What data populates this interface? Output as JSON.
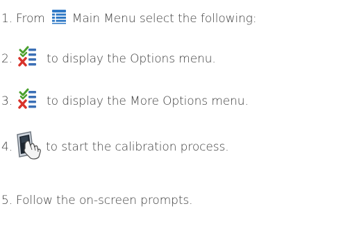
{
  "steps": [
    {
      "number": "1.",
      "prefix": "From",
      "icon": "main-menu-icon",
      "text": "Main Menu select the following:"
    },
    {
      "number": "2.",
      "icon": "options-checklist-icon",
      "text": "to display the Options menu."
    },
    {
      "number": "3.",
      "icon": "options-checklist-icon",
      "text": "to display the More Options menu."
    },
    {
      "number": "4.",
      "icon": "touch-calibration-icon",
      "text": "to start the calibration process."
    },
    {
      "number": "5.",
      "text": "Follow the on-screen prompts."
    }
  ],
  "colors": {
    "text": "#3c3c3c",
    "menu_icon": "#2f79c6",
    "check_green": "#4aa02c",
    "cross_red": "#d8332a",
    "list_blue": "#3b6fb5"
  }
}
